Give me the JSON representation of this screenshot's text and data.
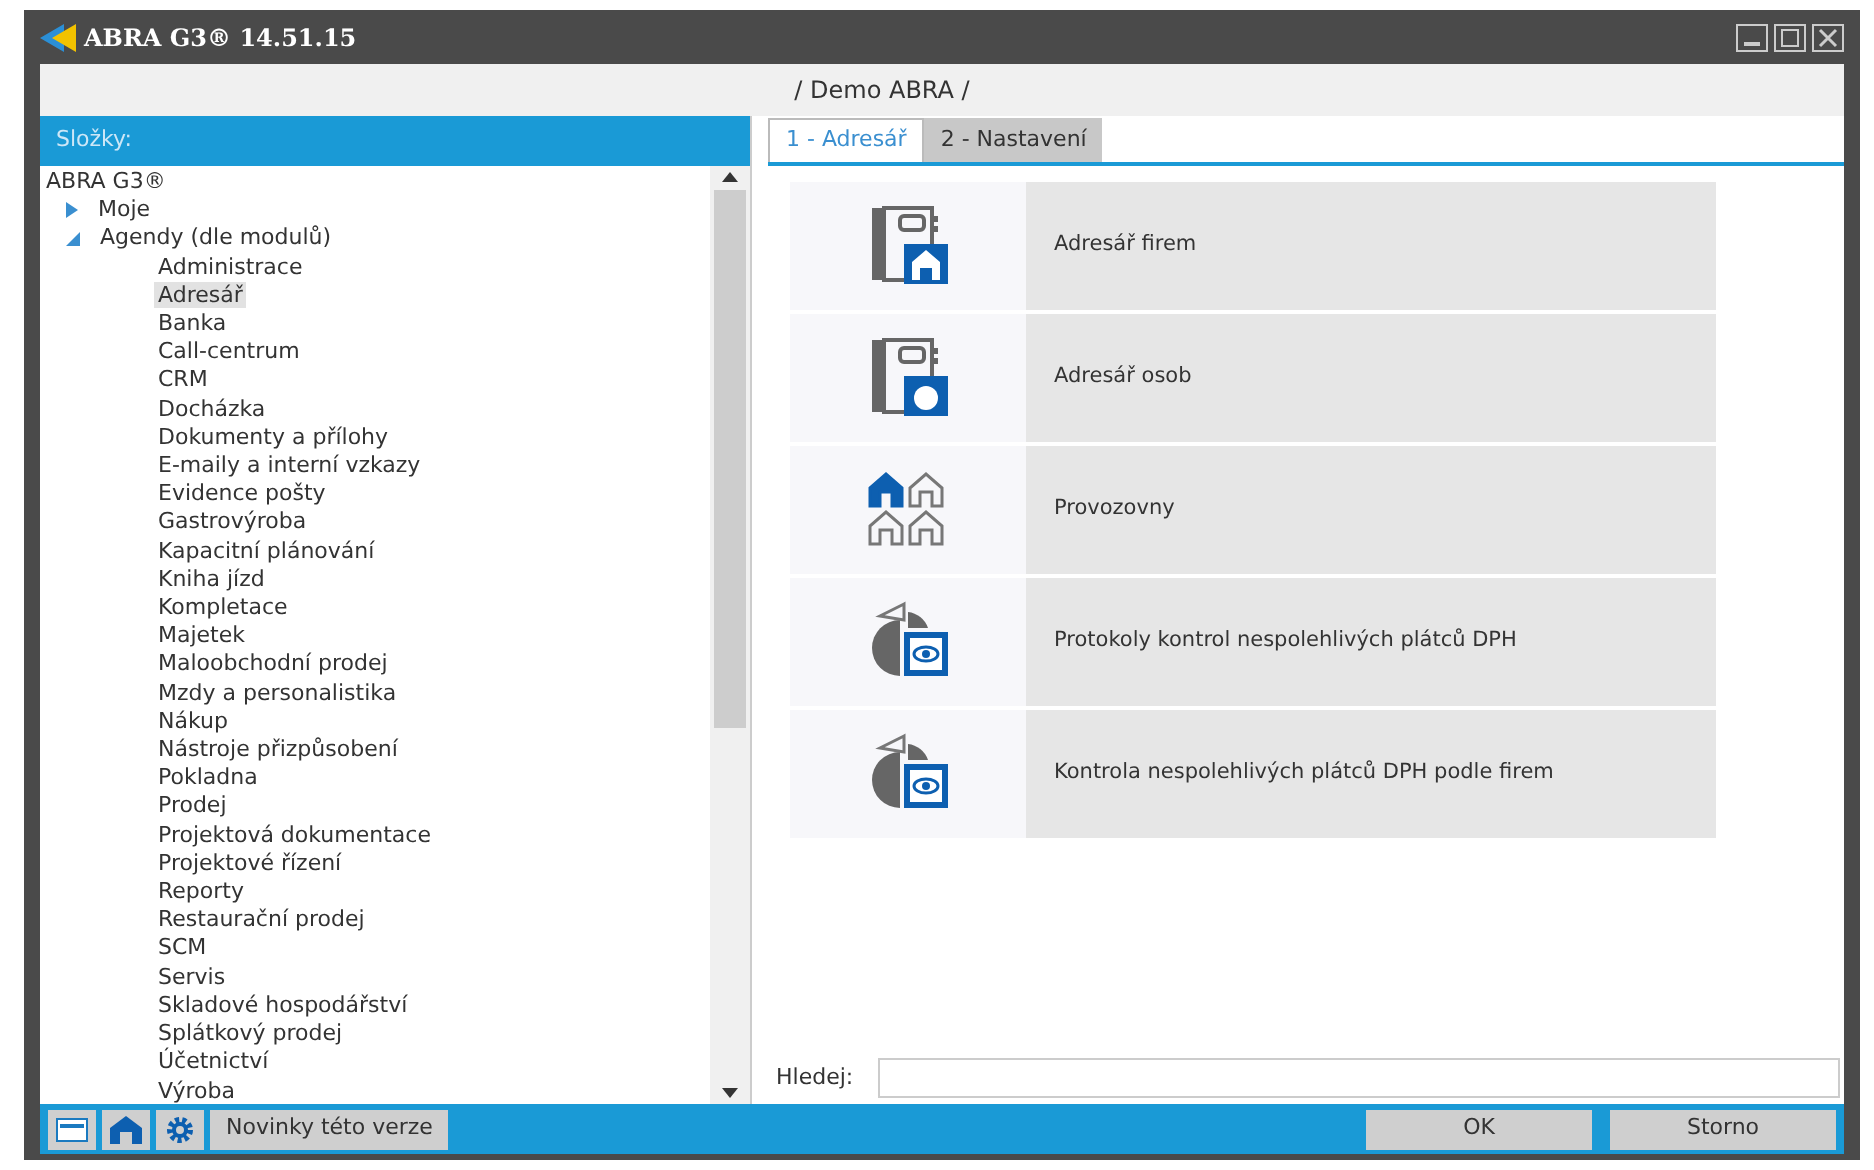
{
  "window": {
    "title": "ABRA G3® 14.51.15"
  },
  "context": "/ Demo ABRA /",
  "sidebar": {
    "header": "Složky:",
    "tree": [
      {
        "label": "ABRA G3®",
        "children": [
          {
            "label": "Moje",
            "expanded": false
          },
          {
            "label": "Agendy (dle modulů)",
            "expanded": true,
            "children": [
              {
                "label": "Administrace",
                "selected": false
              },
              {
                "label": "Adresář",
                "selected": true
              },
              {
                "label": "Banka",
                "selected": false
              },
              {
                "label": "Call-centrum",
                "selected": false
              },
              {
                "label": "CRM",
                "selected": false
              },
              {
                "label": "Docházka",
                "selected": false
              },
              {
                "label": "Dokumenty a přílohy",
                "selected": false
              },
              {
                "label": "E-maily a interní vzkazy",
                "selected": false
              },
              {
                "label": "Evidence pošty",
                "selected": false
              },
              {
                "label": "Gastrovýroba",
                "selected": false
              },
              {
                "label": "Kapacitní plánování",
                "selected": false
              },
              {
                "label": "Kniha jízd",
                "selected": false
              },
              {
                "label": "Kompletace",
                "selected": false
              },
              {
                "label": "Majetek",
                "selected": false
              },
              {
                "label": "Maloobchodní prodej",
                "selected": false
              },
              {
                "label": "Mzdy a personalistika",
                "selected": false
              },
              {
                "label": "Nákup",
                "selected": false
              },
              {
                "label": "Nástroje přizpůsobení",
                "selected": false
              },
              {
                "label": "Pokladna",
                "selected": false
              },
              {
                "label": "Prodej",
                "selected": false
              },
              {
                "label": "Projektová dokumentace",
                "selected": false
              },
              {
                "label": "Projektové řízení",
                "selected": false
              },
              {
                "label": "Reporty",
                "selected": false
              },
              {
                "label": "Restaurační prodej",
                "selected": false
              },
              {
                "label": "SCM",
                "selected": false
              },
              {
                "label": "Servis",
                "selected": false
              },
              {
                "label": "Skladové hospodářství",
                "selected": false
              },
              {
                "label": "Splátkový prodej",
                "selected": false
              },
              {
                "label": "Účetnictví",
                "selected": false
              },
              {
                "label": "Výroba",
                "selected": false
              }
            ]
          }
        ]
      }
    ]
  },
  "tabs": [
    {
      "label": "1 - Adresář",
      "selected": true
    },
    {
      "label": "2 - Nastavení",
      "selected": false
    }
  ],
  "tiles": [
    {
      "kind": "company",
      "label": "Adresář firem"
    },
    {
      "kind": "person",
      "label": "Adresář osob"
    },
    {
      "kind": "branches",
      "label": "Provozovny"
    },
    {
      "kind": "check",
      "label": "Protokoly kontrol nespolehlivých plátců DPH"
    },
    {
      "kind": "check",
      "label": "Kontrola nespolehlivých plátců DPH podle firem"
    }
  ],
  "search": {
    "label": "Hledej:"
  },
  "footer": {
    "news_button": "Novinky této verze",
    "buttons": [
      "OK",
      "Storno"
    ]
  }
}
